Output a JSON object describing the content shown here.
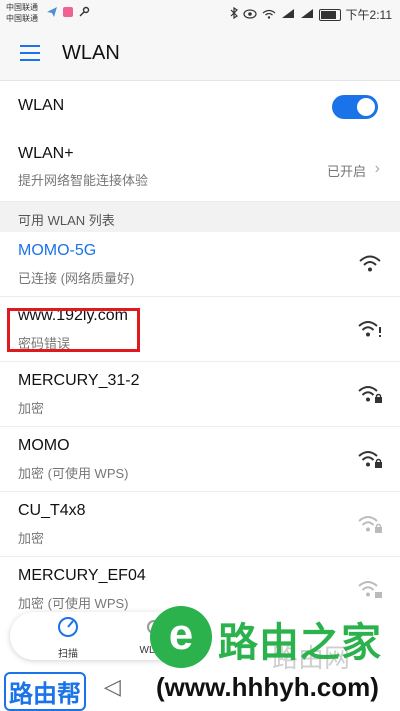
{
  "status_bar": {
    "carrier_1": "中国联通",
    "carrier_2": "中国联通",
    "time": "下午2:11"
  },
  "header": {
    "title": "WLAN"
  },
  "wlan_toggle": {
    "label": "WLAN",
    "state": "on"
  },
  "wlan_plus": {
    "label": "WLAN+",
    "sub": "提升网络智能连接体验",
    "status": "已开启"
  },
  "list_header": "可用 WLAN 列表",
  "networks": [
    {
      "name": "MOMO-5G",
      "status": "已连接 (网络质量好)",
      "icon": "wifi-icon"
    },
    {
      "name": "www.192ly.com",
      "status": "密码错误",
      "icon": "wifi-error-icon"
    },
    {
      "name": "MERCURY_31-2",
      "status": "加密",
      "icon": "wifi-lock-icon"
    },
    {
      "name": "MOMO",
      "status": "加密 (可使用 WPS)",
      "icon": "wifi-lock-icon"
    },
    {
      "name": "CU_T4x8",
      "status": "加密",
      "icon": "wifi-lock-icon"
    },
    {
      "name": "MERCURY_EF04",
      "status": "加密 (可使用 WPS)",
      "icon": "wifi-lock-icon"
    }
  ],
  "bottom_bar": {
    "scan_label": "扫描",
    "wlan_label": "WLAN"
  },
  "watermark": {
    "logo_char": "e",
    "title": "路由之家",
    "url": "(www.hhhyh.com)",
    "left_text": "路由帮",
    "bg_text": "路由网"
  },
  "colors": {
    "accent": "#1a73e8",
    "highlight": "#e0191f",
    "watermark_green": "#2bb24c"
  }
}
